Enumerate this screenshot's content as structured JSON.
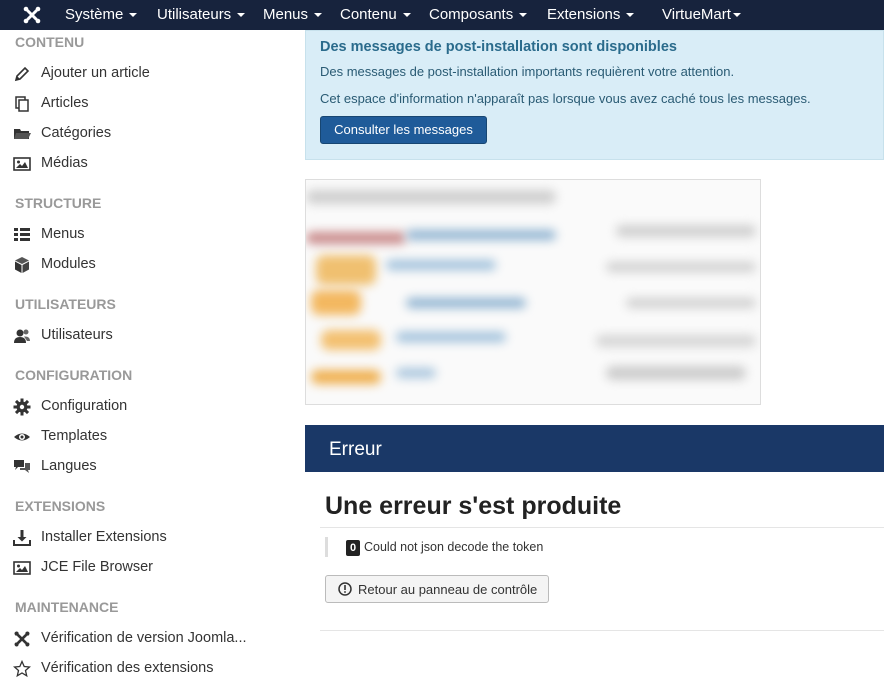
{
  "navbar": {
    "logo_icon": "joomla-icon",
    "items": [
      "Système",
      "Utilisateurs",
      "Menus",
      "Contenu",
      "Composants",
      "Extensions",
      "VirtueMart"
    ]
  },
  "sidebar": {
    "sections": [
      {
        "title": "CONTENU",
        "items": [
          {
            "label": "Ajouter un article",
            "icon": "pencil-icon"
          },
          {
            "label": "Articles",
            "icon": "copy-icon"
          },
          {
            "label": "Catégories",
            "icon": "folder-icon"
          },
          {
            "label": "Médias",
            "icon": "image-icon"
          }
        ]
      },
      {
        "title": "STRUCTURE",
        "items": [
          {
            "label": "Menus",
            "icon": "list-icon"
          },
          {
            "label": "Modules",
            "icon": "cube-icon"
          }
        ]
      },
      {
        "title": "UTILISATEURS",
        "items": [
          {
            "label": "Utilisateurs",
            "icon": "users-icon"
          }
        ]
      },
      {
        "title": "CONFIGURATION",
        "items": [
          {
            "label": "Configuration",
            "icon": "gear-icon"
          },
          {
            "label": "Templates",
            "icon": "eye-icon"
          },
          {
            "label": "Langues",
            "icon": "comments-icon"
          }
        ]
      },
      {
        "title": "EXTENSIONS",
        "items": [
          {
            "label": "Installer Extensions",
            "icon": "download-icon"
          },
          {
            "label": "JCE File Browser",
            "icon": "image-icon"
          }
        ]
      },
      {
        "title": "MAINTENANCE",
        "items": [
          {
            "label": "Vérification de version Joomla...",
            "icon": "joomla-icon"
          },
          {
            "label": "Vérification des extensions",
            "icon": "star-icon"
          }
        ]
      }
    ]
  },
  "alert": {
    "title": "Des messages de post-installation sont disponibles",
    "line1": "Des messages de post-installation importants requièrent votre attention.",
    "line2": "Cet espace d'information n'apparaît pas lorsque vous avez caché tous les messages.",
    "button": "Consulter les messages"
  },
  "error": {
    "header": "Erreur",
    "title": "Une erreur s'est produite",
    "code": "0",
    "message": "Could not json decode the token",
    "back_button": "Retour au panneau de contrôle"
  },
  "colors": {
    "navbar": "#17233d",
    "error_header": "#1a3867",
    "alert_bg": "#d9edf7",
    "primary_button": "#1f5b99"
  }
}
